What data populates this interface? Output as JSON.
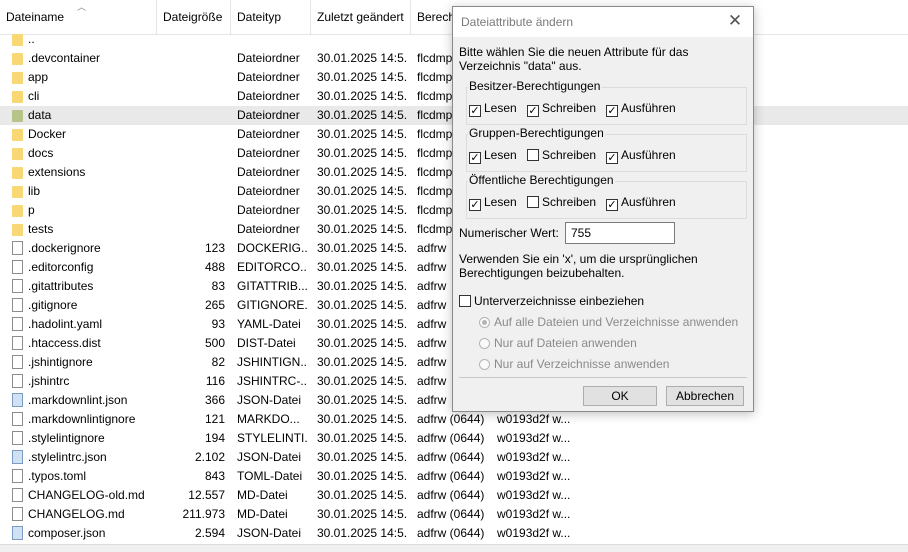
{
  "columns": {
    "name": "Dateiname",
    "size": "Dateigröße",
    "type": "Dateityp",
    "modified": "Zuletzt geändert",
    "perms": "Berech"
  },
  "files": [
    {
      "name": "..",
      "size": "",
      "type": "",
      "modified": "",
      "perms": "",
      "owner": "",
      "icon": "folder-up"
    },
    {
      "name": ".devcontainer",
      "size": "",
      "type": "Dateiordner",
      "modified": "30.01.2025 14:5...",
      "perms": "flcdmp",
      "owner": "",
      "icon": "folder"
    },
    {
      "name": "app",
      "size": "",
      "type": "Dateiordner",
      "modified": "30.01.2025 14:5...",
      "perms": "flcdmp",
      "owner": "",
      "icon": "folder"
    },
    {
      "name": "cli",
      "size": "",
      "type": "Dateiordner",
      "modified": "30.01.2025 14:5...",
      "perms": "flcdmp",
      "owner": "",
      "icon": "folder"
    },
    {
      "name": "data",
      "size": "",
      "type": "Dateiordner",
      "modified": "30.01.2025 14:5...",
      "perms": "flcdmp",
      "owner": "",
      "icon": "folder-dark",
      "selected": true
    },
    {
      "name": "Docker",
      "size": "",
      "type": "Dateiordner",
      "modified": "30.01.2025 14:5...",
      "perms": "flcdmp",
      "owner": "",
      "icon": "folder"
    },
    {
      "name": "docs",
      "size": "",
      "type": "Dateiordner",
      "modified": "30.01.2025 14:5...",
      "perms": "flcdmp",
      "owner": "",
      "icon": "folder"
    },
    {
      "name": "extensions",
      "size": "",
      "type": "Dateiordner",
      "modified": "30.01.2025 14:5...",
      "perms": "flcdmp",
      "owner": "",
      "icon": "folder"
    },
    {
      "name": "lib",
      "size": "",
      "type": "Dateiordner",
      "modified": "30.01.2025 14:5...",
      "perms": "flcdmp",
      "owner": "",
      "icon": "folder"
    },
    {
      "name": "p",
      "size": "",
      "type": "Dateiordner",
      "modified": "30.01.2025 14:5...",
      "perms": "flcdmp",
      "owner": "",
      "icon": "folder"
    },
    {
      "name": "tests",
      "size": "",
      "type": "Dateiordner",
      "modified": "30.01.2025 14:5...",
      "perms": "flcdmp",
      "owner": "",
      "icon": "folder"
    },
    {
      "name": ".dockerignore",
      "size": "123",
      "type": "DOCKERIG...",
      "modified": "30.01.2025 14:5...",
      "perms": "adfrw",
      "owner": "",
      "icon": "doc"
    },
    {
      "name": ".editorconfig",
      "size": "488",
      "type": "EDITORCO...",
      "modified": "30.01.2025 14:5...",
      "perms": "adfrw",
      "owner": "",
      "icon": "doc"
    },
    {
      "name": ".gitattributes",
      "size": "83",
      "type": "GITATTRIB...",
      "modified": "30.01.2025 14:5...",
      "perms": "adfrw",
      "owner": "",
      "icon": "doc"
    },
    {
      "name": ".gitignore",
      "size": "265",
      "type": "GITIGNORE...",
      "modified": "30.01.2025 14:5...",
      "perms": "adfrw",
      "owner": "",
      "icon": "doc"
    },
    {
      "name": ".hadolint.yaml",
      "size": "93",
      "type": "YAML-Datei",
      "modified": "30.01.2025 14:5...",
      "perms": "adfrw",
      "owner": "",
      "icon": "doc"
    },
    {
      "name": ".htaccess.dist",
      "size": "500",
      "type": "DIST-Datei",
      "modified": "30.01.2025 14:5...",
      "perms": "adfrw",
      "owner": "",
      "icon": "doc"
    },
    {
      "name": ".jshintignore",
      "size": "82",
      "type": "JSHINTIGN...",
      "modified": "30.01.2025 14:5...",
      "perms": "adfrw",
      "owner": "",
      "icon": "doc"
    },
    {
      "name": ".jshintrc",
      "size": "116",
      "type": "JSHINTRC-...",
      "modified": "30.01.2025 14:5...",
      "perms": "adfrw",
      "owner": "",
      "icon": "doc"
    },
    {
      "name": ".markdownlint.json",
      "size": "366",
      "type": "JSON-Datei",
      "modified": "30.01.2025 14:5...",
      "perms": "adfrw",
      "owner": "",
      "icon": "doc-blue"
    },
    {
      "name": ".markdownlintignore",
      "size": "121",
      "type": "MARKDO...",
      "modified": "30.01.2025 14:5...",
      "perms": "adfrw (0644)",
      "owner": "w0193d2f w...",
      "icon": "doc"
    },
    {
      "name": ".stylelintignore",
      "size": "194",
      "type": "STYLELINTI...",
      "modified": "30.01.2025 14:5...",
      "perms": "adfrw (0644)",
      "owner": "w0193d2f w...",
      "icon": "doc"
    },
    {
      "name": ".stylelintrc.json",
      "size": "2.102",
      "type": "JSON-Datei",
      "modified": "30.01.2025 14:5...",
      "perms": "adfrw (0644)",
      "owner": "w0193d2f w...",
      "icon": "doc-blue"
    },
    {
      "name": ".typos.toml",
      "size": "843",
      "type": "TOML-Datei",
      "modified": "30.01.2025 14:5...",
      "perms": "adfrw (0644)",
      "owner": "w0193d2f w...",
      "icon": "doc"
    },
    {
      "name": "CHANGELOG-old.md",
      "size": "12.557",
      "type": "MD-Datei",
      "modified": "30.01.2025 14:5...",
      "perms": "adfrw (0644)",
      "owner": "w0193d2f w...",
      "icon": "doc"
    },
    {
      "name": "CHANGELOG.md",
      "size": "211.973",
      "type": "MD-Datei",
      "modified": "30.01.2025 14:5...",
      "perms": "adfrw (0644)",
      "owner": "w0193d2f w...",
      "icon": "doc"
    },
    {
      "name": "composer.json",
      "size": "2.594",
      "type": "JSON-Datei",
      "modified": "30.01.2025 14:5...",
      "perms": "adfrw (0644)",
      "owner": "w0193d2f w...",
      "icon": "doc-blue"
    }
  ],
  "dialog": {
    "title": "Dateiattribute ändern",
    "intro": "Bitte wählen Sie die neuen Attribute für das Verzeichnis \"data\" aus.",
    "groups": [
      {
        "title": "Besitzer-Berechtigungen",
        "read": true,
        "write": true,
        "exec": true
      },
      {
        "title": "Gruppen-Berechtigungen",
        "read": true,
        "write": false,
        "exec": true
      },
      {
        "title": "Öffentliche Berechtigungen",
        "read": true,
        "write": false,
        "exec": true
      }
    ],
    "read_label": "Lesen",
    "write_label": "Schreiben",
    "exec_label": "Ausführen",
    "numeric_label": "Numerischer Wert:",
    "numeric_value": "755",
    "hint": "Verwenden Sie ein 'x', um die ursprünglichen Berechtigungen beizubehalten.",
    "recurse_label": "Unterverzeichnisse einbeziehen",
    "recurse_checked": false,
    "radio_options": [
      {
        "label": "Auf alle Dateien und Verzeichnisse anwenden",
        "selected": true
      },
      {
        "label": "Nur auf Dateien anwenden",
        "selected": false
      },
      {
        "label": "Nur auf Verzeichnisse anwenden",
        "selected": false
      }
    ],
    "ok_label": "OK",
    "cancel_label": "Abbrechen"
  },
  "colors": {
    "folder": "#f8d775",
    "selected_row": "#e9e9e9",
    "dialog_bg": "#f0f0f0"
  }
}
